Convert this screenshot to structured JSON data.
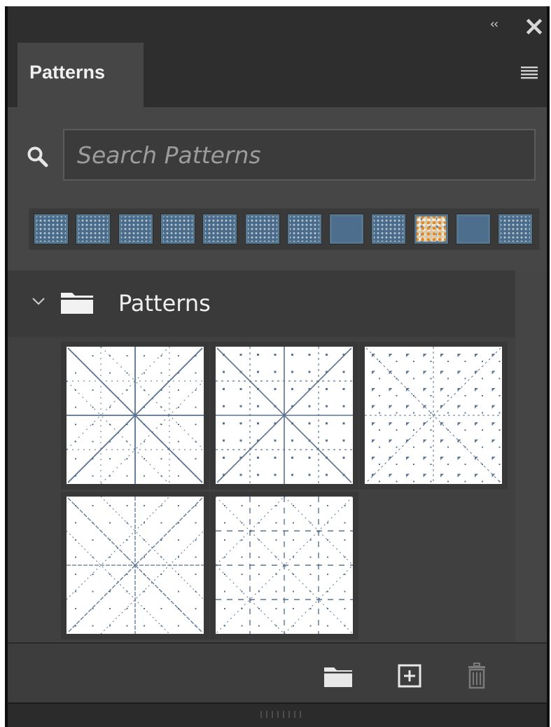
{
  "panel": {
    "tab_label": "Patterns",
    "collapse_label": "‹‹",
    "icons": {
      "collapse": "double-chevron-left-icon",
      "close": "close-icon",
      "menu": "hamburger-menu-icon"
    }
  },
  "search": {
    "placeholder": "Search Patterns",
    "value": "",
    "icon": "search-icon"
  },
  "recent_swatches": [
    {
      "kind": "dotted"
    },
    {
      "kind": "dotted"
    },
    {
      "kind": "dotted"
    },
    {
      "kind": "dotted"
    },
    {
      "kind": "dotted"
    },
    {
      "kind": "dotted"
    },
    {
      "kind": "dotted"
    },
    {
      "kind": "solid"
    },
    {
      "kind": "dotted"
    },
    {
      "kind": "colorful"
    },
    {
      "kind": "solid"
    },
    {
      "kind": "dotted"
    }
  ],
  "group": {
    "label": "Patterns",
    "expanded": true,
    "icons": {
      "chevron": "chevron-down-icon",
      "folder": "folder-icon"
    }
  },
  "patterns": [
    {
      "style": "star-lines"
    },
    {
      "style": "star-dots"
    },
    {
      "style": "triangle-dots"
    },
    {
      "style": "star-fine"
    },
    {
      "style": "grid-dashes"
    }
  ],
  "footer": {
    "icons": [
      "new-group-folder-icon",
      "new-pattern-plus-icon",
      "trash-icon"
    ]
  },
  "colors": {
    "panel_bg": "#323232",
    "content_bg": "#464646",
    "swatch_blue": "#4d6e8c",
    "pattern_ink": "#5a7390"
  }
}
